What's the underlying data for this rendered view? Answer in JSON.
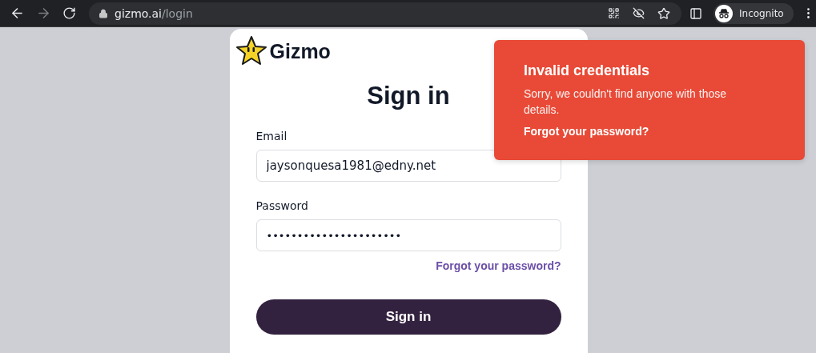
{
  "browser": {
    "back_disabled": false,
    "forward_disabled": true,
    "url_host": "gizmo.ai",
    "url_path": "/login",
    "profile_label": "Incognito"
  },
  "logo": {
    "name": "Gizmo"
  },
  "form": {
    "title": "Sign in",
    "fields": [
      {
        "label": "Email",
        "value": "jaysonquesa1981@edny.net"
      },
      {
        "label": "Password",
        "value": "••••••••••••••••••••••"
      }
    ],
    "forgot_link": "Forgot your password?",
    "submit": "Sign in"
  },
  "toast": {
    "kind": "error",
    "title": "Invalid credentials",
    "message": "Sorry, we couldn't find anyone with those details.",
    "link": "Forgot your password?"
  }
}
